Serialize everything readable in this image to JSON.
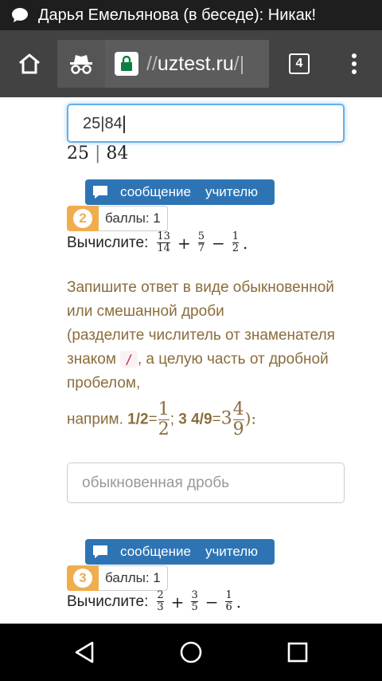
{
  "status_bar": {
    "notification": "Дарья Емельянова (в беседе): Никак!"
  },
  "browser": {
    "url_prefix": "//",
    "url_domain": "uztest.ru",
    "url_suffix": "/|",
    "tab_count": "4"
  },
  "question1": {
    "answer_value": "25|84",
    "preview_left": "25",
    "preview_sep": "|",
    "preview_right": "84"
  },
  "message_button": {
    "word1": "сообщение",
    "word2": "учителю"
  },
  "question2": {
    "number": "2",
    "points": "баллы: 1",
    "prompt": "Вычислите:",
    "terms": [
      {
        "num": "13",
        "den": "14"
      },
      {
        "num": "5",
        "den": "7"
      },
      {
        "num": "1",
        "den": "2"
      }
    ],
    "ops": [
      "+",
      "−"
    ],
    "end": ".",
    "instr_line1": "Запишите ответ в виде обыкновенной или смешанной дроби",
    "instr_line2a": "(разделите числитель от знаменателя знаком",
    "instr_code": "/",
    "instr_line2b": ", а целую часть от дробной пробелом,",
    "instr_example_prefix": "наприм.",
    "ex1_text": "1/2",
    "ex1_eq": "=",
    "ex1_num": "1",
    "ex1_den": "2",
    "ex_sep": ";",
    "ex2_text": "3 4/9",
    "ex2_eq": "=",
    "ex2_whole": "3",
    "ex2_num": "4",
    "ex2_den": "9",
    "ex_close": "):",
    "placeholder": "обыкновенная дробь"
  },
  "question3": {
    "number": "3",
    "points": "баллы: 1",
    "prompt": "Вычислите:",
    "terms": [
      {
        "num": "2",
        "den": "3"
      },
      {
        "num": "3",
        "den": "5"
      },
      {
        "num": "1",
        "den": "6"
      }
    ],
    "ops": [
      "+",
      "−"
    ],
    "end": "."
  }
}
